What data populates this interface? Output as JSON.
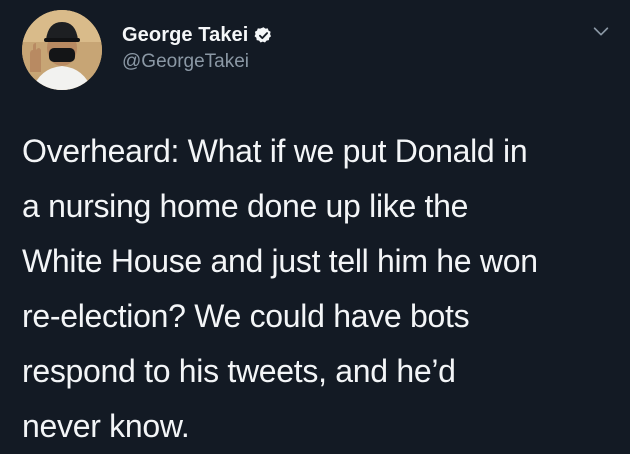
{
  "author": {
    "display_name": "George Takei",
    "handle": "@GeorgeTakei"
  },
  "icons": {
    "verified": "verified-badge-icon",
    "more": "chevron-down-icon"
  },
  "colors": {
    "background": "#131a24",
    "text": "#f3f5f7",
    "secondary_text": "#8b98a5"
  },
  "tweet": {
    "lines": [
      "Overheard: What if we put Donald in",
      "a nursing home done up like the",
      "White House and just tell him he won",
      "re-election? We could have bots",
      "respond to his tweets, and he’d",
      "never know."
    ]
  }
}
